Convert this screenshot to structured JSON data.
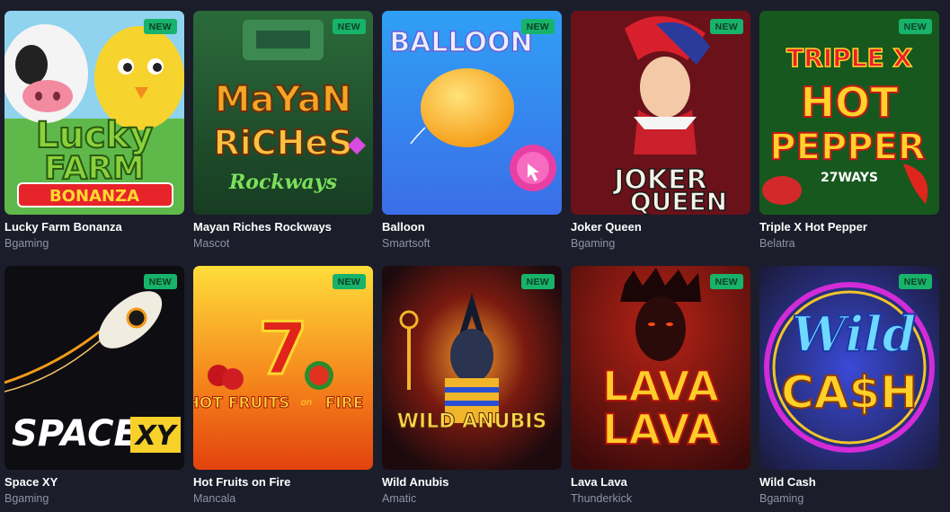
{
  "games": [
    {
      "title": "Lucky Farm Bonanza",
      "provider": "Bgaming",
      "badge": "NEW",
      "art_lines": [
        "Lucky",
        "FARM",
        "BONANZA"
      ]
    },
    {
      "title": "Mayan Riches Rockways",
      "provider": "Mascot",
      "badge": "NEW",
      "art_lines": [
        "MaYaN",
        "RiCHeS",
        "Rockways"
      ]
    },
    {
      "title": "Balloon",
      "provider": "Smartsoft",
      "badge": "NEW",
      "art_lines": [
        "BALLOON"
      ]
    },
    {
      "title": "Joker Queen",
      "provider": "Bgaming",
      "badge": "NEW",
      "art_lines": [
        "JOKER",
        "QUEEN"
      ]
    },
    {
      "title": "Triple X Hot Pepper",
      "provider": "Belatra",
      "badge": "NEW",
      "art_lines": [
        "TRIPLE X",
        "HOT",
        "PEPPER",
        "27WAYS"
      ]
    },
    {
      "title": "Space XY",
      "provider": "Bgaming",
      "badge": "NEW",
      "art_lines": [
        "SPACE",
        "XY"
      ]
    },
    {
      "title": "Hot Fruits on Fire",
      "provider": "Mancala",
      "badge": "NEW",
      "art_lines": [
        "7",
        "HOT FRUITS",
        "on",
        "FIRE"
      ]
    },
    {
      "title": "Wild Anubis",
      "provider": "Amatic",
      "badge": "NEW",
      "art_lines": [
        "WILD ANUBIS"
      ]
    },
    {
      "title": "Lava Lava",
      "provider": "Thunderkick",
      "badge": "NEW",
      "art_lines": [
        "LAVA",
        "LAVA"
      ]
    },
    {
      "title": "Wild Cash",
      "provider": "Bgaming",
      "badge": "NEW",
      "art_lines": [
        "Wild",
        "CA$H"
      ]
    }
  ],
  "colors": {
    "background": "#1b1d2a",
    "badge": "#17b36a",
    "provider_text": "#8e93a8",
    "title_text": "#ffffff"
  }
}
